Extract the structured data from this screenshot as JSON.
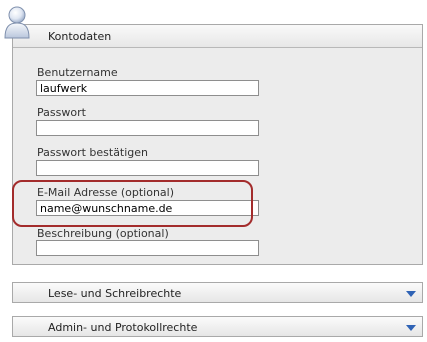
{
  "account_panel": {
    "title": "Kontodaten",
    "fields": {
      "username": {
        "label": "Benutzername",
        "value": "laufwerk"
      },
      "password": {
        "label": "Passwort",
        "value": ""
      },
      "password_confirm": {
        "label": "Passwort bestätigen",
        "value": ""
      },
      "email": {
        "label": "E-Mail Adresse (optional)",
        "value": "name@wunschname.de"
      },
      "description": {
        "label": "Beschreibung (optional)",
        "value": ""
      }
    }
  },
  "sections": [
    {
      "label": "Lese- und Schreibrechte",
      "icon": "chevron-down-icon",
      "expanded": false
    },
    {
      "label": "Admin- und Protokollrechte",
      "icon": "chevron-down-icon",
      "expanded": false
    }
  ],
  "colors": {
    "highlight": "#a32c2c",
    "chevron": "#2f63b5",
    "panel_background": "#ececec"
  }
}
